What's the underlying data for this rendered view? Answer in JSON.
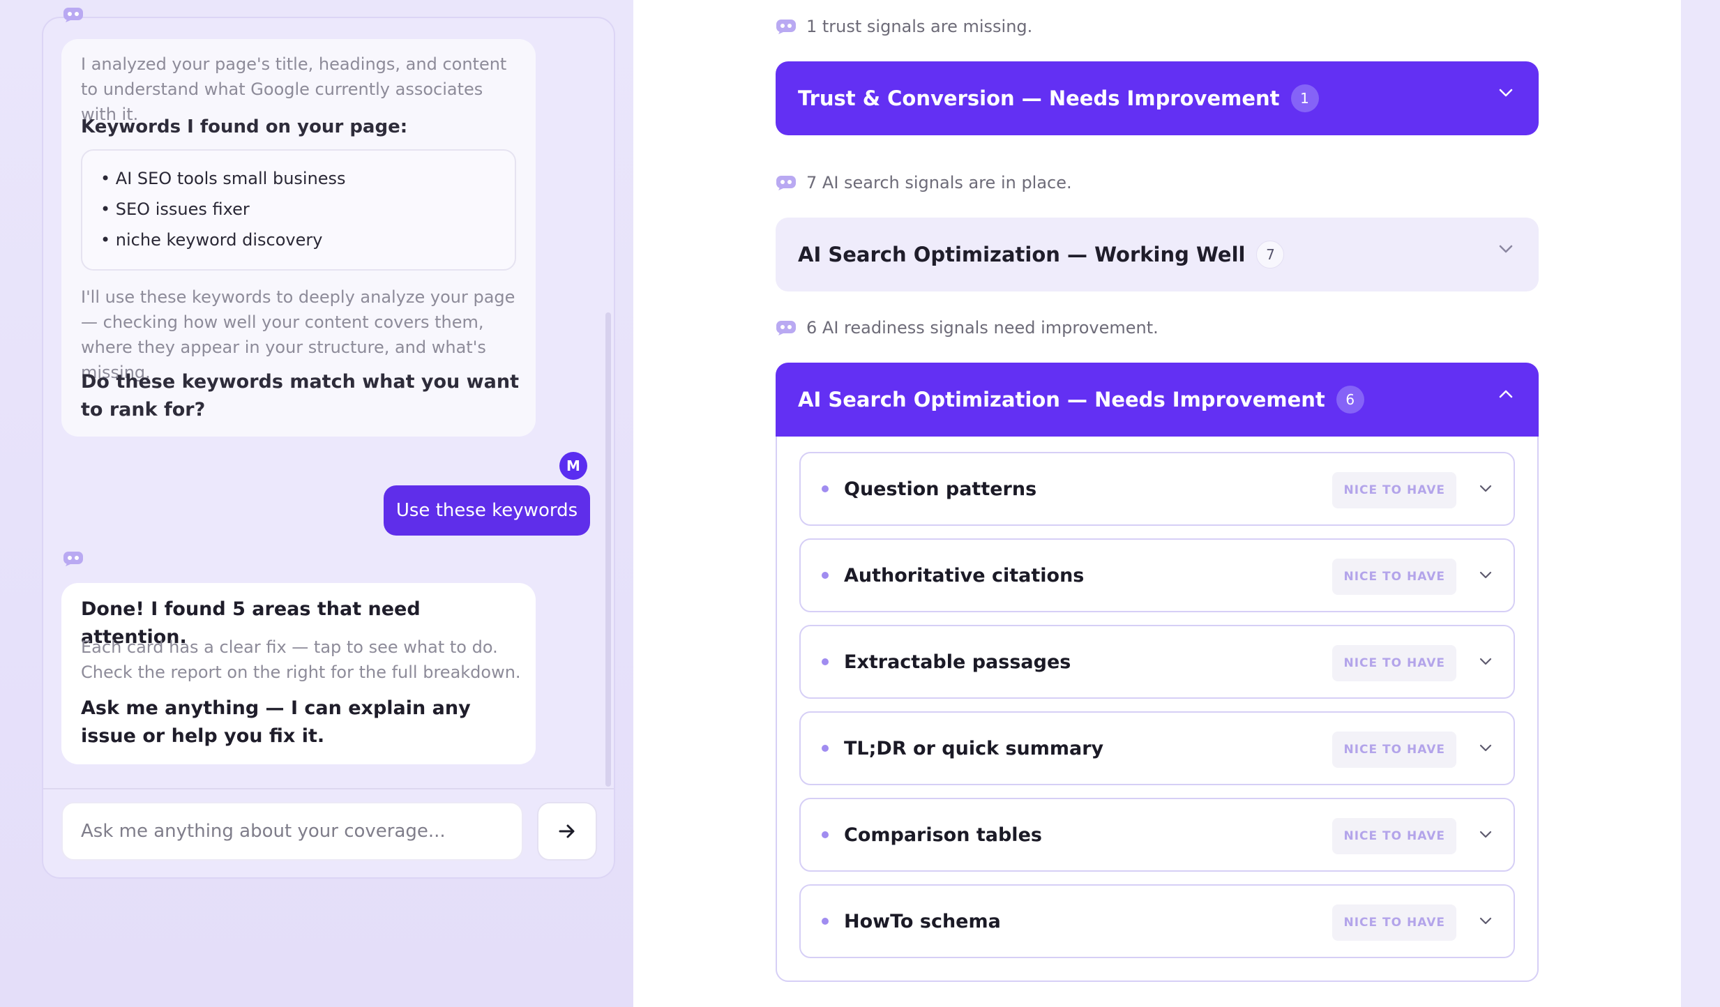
{
  "chat": {
    "intro_text": "I analyzed your page's title, headings, and content to understand what Google currently associates with it.",
    "keywords_heading": "Keywords I found on your page:",
    "keywords": [
      "• AI SEO tools small business",
      "• SEO issues fixer",
      "• niche keyword discovery"
    ],
    "keywords_followup": "I'll use these keywords to deeply analyze your page — checking how well your content covers them, where they appear in your structure, and what's missing.",
    "keywords_question": "Do these keywords match what you want to rank for?",
    "user_avatar_initial": "M",
    "user_message": "Use these keywords",
    "done_heading": "Done! I found 5 areas that need attention.",
    "done_text": "Each card has a clear fix — tap to see what to do. Check the report on the right for the full breakdown.",
    "done_cta": "Ask me anything — I can explain any issue or help you fix it.",
    "input_placeholder": "Ask me anything about your coverage..."
  },
  "report": {
    "sections": [
      {
        "status": "1 trust signals are missing.",
        "title": "Trust & Conversion — Needs Improvement",
        "count": "1",
        "style": "dark",
        "expanded": false
      },
      {
        "status": "7 AI search signals are in place.",
        "title": "AI Search Optimization — Working Well",
        "count": "7",
        "style": "light",
        "expanded": false
      },
      {
        "status": "6 AI readiness signals need improvement.",
        "title": "AI Search Optimization — Needs Improvement",
        "count": "6",
        "style": "dark",
        "expanded": true
      }
    ],
    "items": [
      {
        "label": "Question patterns",
        "badge": "NICE TO HAVE"
      },
      {
        "label": "Authoritative citations",
        "badge": "NICE TO HAVE"
      },
      {
        "label": "Extractable passages",
        "badge": "NICE TO HAVE"
      },
      {
        "label": "TL;DR or quick summary",
        "badge": "NICE TO HAVE"
      },
      {
        "label": "Comparison tables",
        "badge": "NICE TO HAVE"
      },
      {
        "label": "HowTo schema",
        "badge": "NICE TO HAVE"
      }
    ]
  },
  "colors": {
    "accent": "#6330f3",
    "light_section": "#efecfb",
    "badge_text": "#b3a4ea"
  },
  "icons": {
    "bot": "assistant-bot-icon",
    "send": "arrow-right-icon",
    "chevron": "chevron-icon"
  }
}
